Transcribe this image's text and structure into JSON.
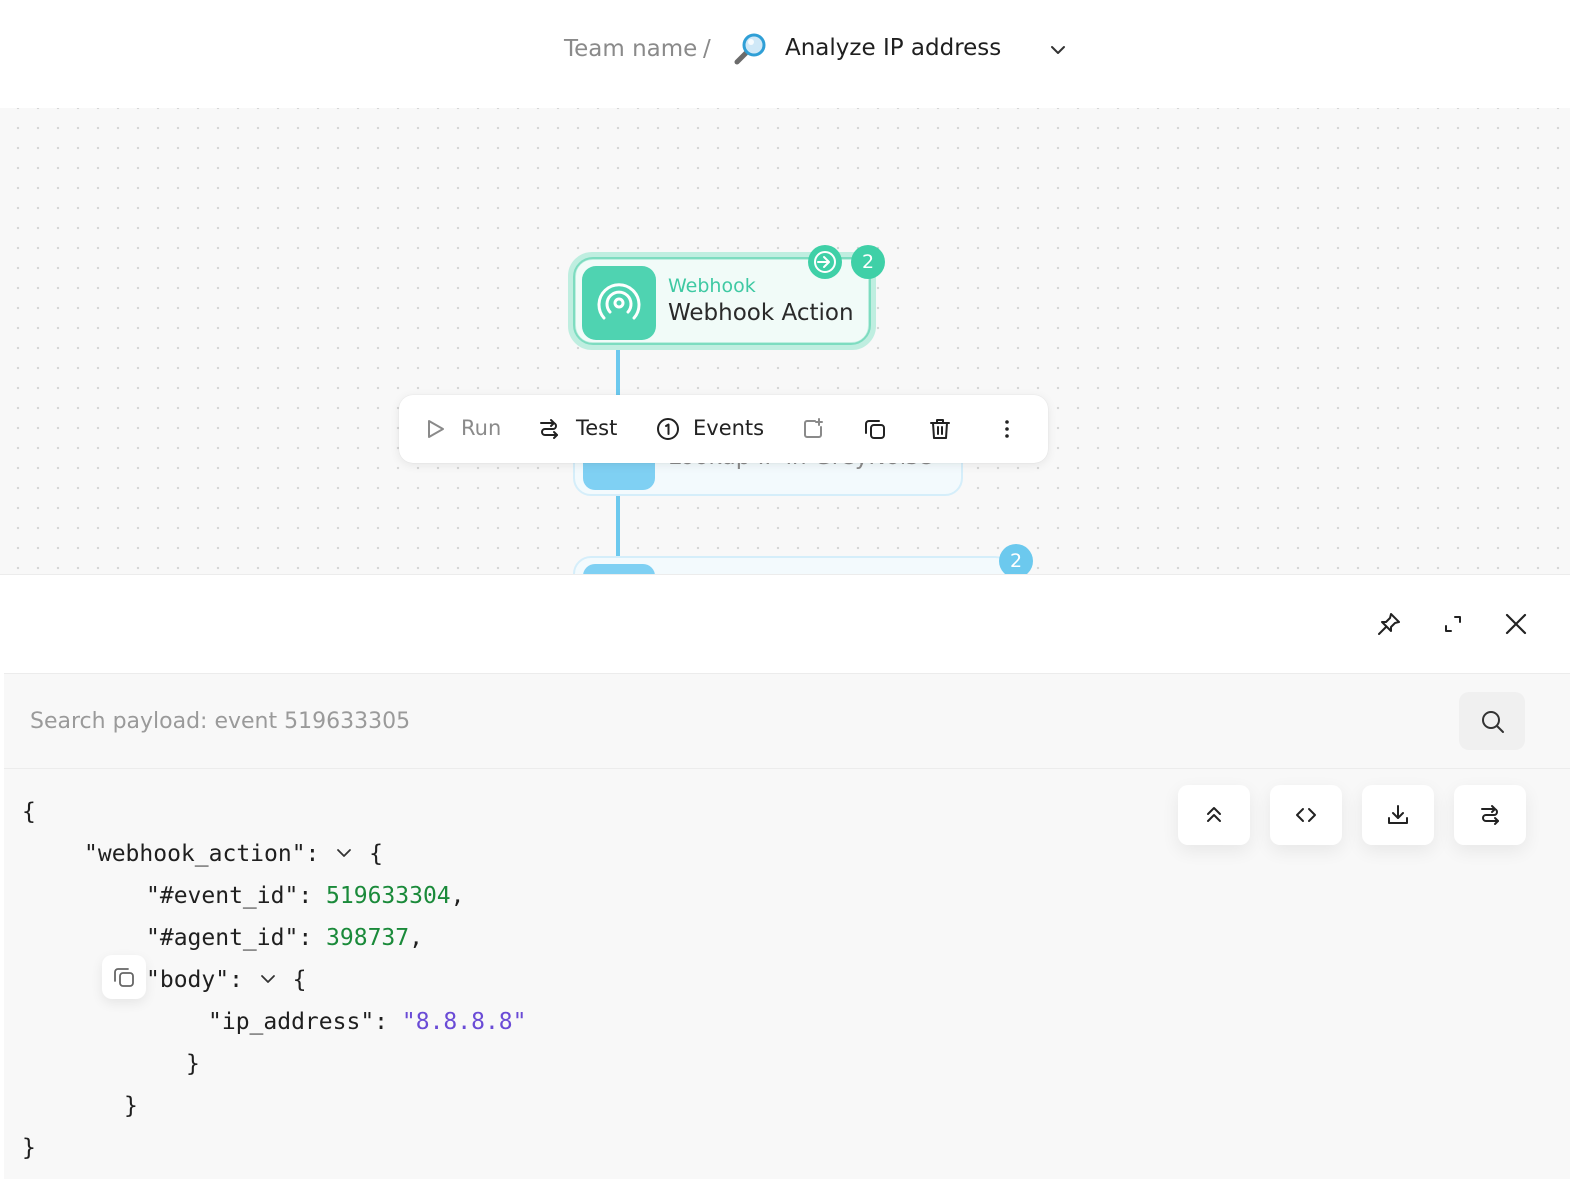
{
  "header": {
    "team_name": "Team name",
    "separator": "/",
    "story_emoji": "magnifying-glass-tilted-right",
    "story_title": "Analyze IP address"
  },
  "canvas": {
    "webhook_node": {
      "type_label": "Webhook",
      "name": "Webhook Action",
      "event_count": "2",
      "icon": "broadcast-icon"
    },
    "greynoise_node": {
      "name": "Lookup IP in GreyNoise"
    },
    "third_node": {
      "event_count": "2"
    },
    "toolbar": {
      "run_label": "Run",
      "test_label": "Test",
      "events_label": "Events"
    }
  },
  "panel": {
    "search": {
      "placeholder": "Search payload: event 519633305"
    },
    "payload": {
      "open_brace": "{",
      "webhook_key": "\"webhook_action\":",
      "event_id_key": "\"#event_id\":",
      "event_id_value": "519633304",
      "agent_id_key": "\"#agent_id\":",
      "agent_id_value": "398737",
      "body_key": "\"body\":",
      "ip_key": "\"ip_address\":",
      "ip_value": "\"8.8.8.8\"",
      "close_brace": "}"
    }
  },
  "colors": {
    "accent_green": "#4fd3b1",
    "accent_blue": "#6cc9ee",
    "number_color": "#1a8a3a",
    "string_color": "#6a4bd6"
  }
}
